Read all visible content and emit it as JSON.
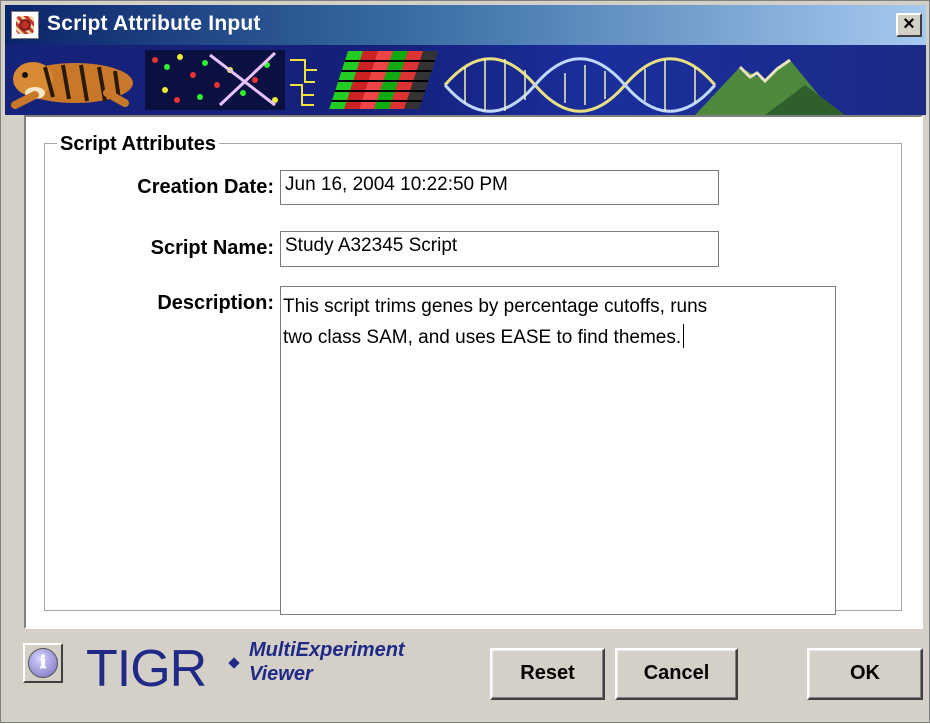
{
  "window": {
    "title": "Script Attribute Input",
    "close_label": "×",
    "title_icon": "tigr-app-icon"
  },
  "banner": {
    "image": "tiger-dna-microarray-banner"
  },
  "group": {
    "title": "Script Attributes"
  },
  "fields": {
    "creation_date": {
      "label": "Creation Date:",
      "value": "Jun 16, 2004 10:22:50 PM"
    },
    "script_name": {
      "label": "Script Name:",
      "value": "Study A32345 Script"
    },
    "description": {
      "label": "Description:",
      "lines": [
        "This script trims genes by percentage cutoffs, runs",
        "two class SAM, and uses EASE to find themes."
      ]
    }
  },
  "footer": {
    "info_icon": "info-icon",
    "info_glyph": "ℹ",
    "logo_main": "TIGR",
    "logo_line1": "MultiExperiment",
    "logo_line2": "Viewer",
    "brand_color": "#1f2a86"
  },
  "buttons": {
    "reset": "Reset",
    "cancel": "Cancel",
    "ok": "OK"
  }
}
